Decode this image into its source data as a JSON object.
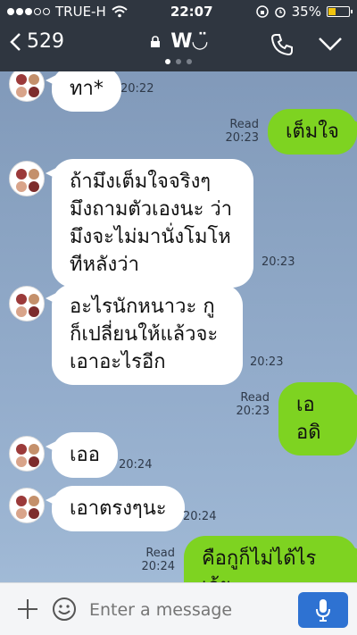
{
  "status_bar": {
    "carrier": "TRUE-H",
    "time": "22:07",
    "battery": "35%",
    "battery_level": 0.35
  },
  "header": {
    "back_count": "529",
    "chat_title": "W◡̈",
    "page_indicator_active": 1,
    "page_indicator_count": 3
  },
  "messages": [
    {
      "side": "in",
      "text": "ทา*",
      "time": "20:22"
    },
    {
      "side": "out",
      "text": "เต็มใจ",
      "read": "Read",
      "time": "20:23"
    },
    {
      "side": "in",
      "text": "ถ้ามึงเต็มใจจริงๆ มึงถามตัวเองนะ ว่ามึงจะไม่มานั่งโมโหทีหลังว่า",
      "time": "20:23"
    },
    {
      "side": "in",
      "text": "อะไรนักหนาวะ กูก็เปลี่ยนให้แล้วจะเอาอะไรอีก",
      "time": "20:23"
    },
    {
      "side": "out",
      "text": "เออดิ",
      "read": "Read",
      "time": "20:23"
    },
    {
      "side": "in",
      "text": "เออ",
      "time": "20:24"
    },
    {
      "side": "in",
      "text": "เอาตรงๆนะ",
      "time": "20:24"
    },
    {
      "side": "out",
      "text": "คือกูก็ไม่ได้ไรเว้ย",
      "read": "Read",
      "time": "20:24"
    }
  ],
  "footer": {
    "input_placeholder": "Enter a message"
  },
  "colors": {
    "header_bg": "#2f3640",
    "outgoing_bubble": "#7ed321",
    "incoming_bubble": "#ffffff",
    "mic_button": "#2e72d2"
  }
}
